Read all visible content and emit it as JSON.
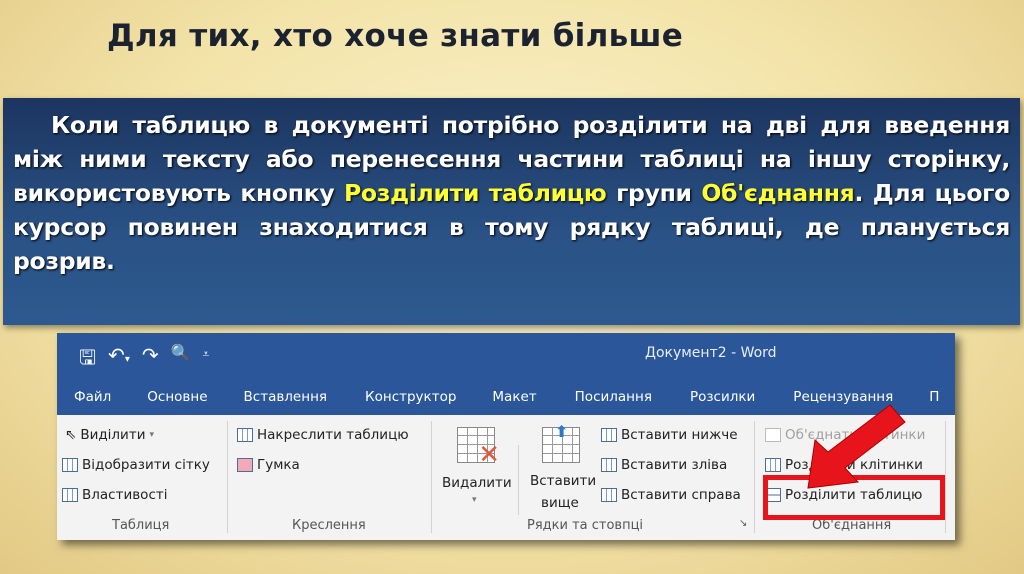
{
  "slide_title": "Для тих, хто хоче знати більше",
  "text": {
    "p1": "Коли таблицю в документі потрібно розділити на дві для введення між ними тексту або перенесення частини таблиці на іншу сторінку, використовують кнопку ",
    "hl1": "Розділити таблицю",
    "p2": " групи ",
    "hl2": "Об'єднання",
    "p3": ". Для цього курсор повинен знаходитися в тому рядку таблиці, де планується розрив."
  },
  "word": {
    "title": "Документ2 - Word",
    "qat": {
      "save": "🖫",
      "undo": "↶",
      "undo_more": "▾",
      "redo": "↷",
      "preview": "🔍",
      "customize": "⩡"
    },
    "tabs": [
      "Файл",
      "Основне",
      "Вставлення",
      "Конструктор",
      "Макет",
      "Посилання",
      "Розсилки",
      "Рецензування",
      "П"
    ],
    "ribbon": {
      "select": "Виділити",
      "select_caret": "▾",
      "gridlines": "Відобразити сітку",
      "properties": "Властивості",
      "group_table": "Таблиця",
      "draw_table": "Накреслити таблицю",
      "eraser": "Гумка",
      "group_draw": "Креслення",
      "delete": "Видалити",
      "delete_caret": "▾",
      "insert_above_1": "Вставити",
      "insert_above_2": "вище",
      "insert_below": "Вставити нижче",
      "insert_left": "Вставити зліва",
      "insert_right": "Вставити справа",
      "group_rows": "Рядки та стовпці",
      "launcher": "↘",
      "merge_cells": "Об'єднати клітинки",
      "split_cells": "Розділити клітинки",
      "split_table": "Розділити таблицю",
      "group_merge": "Об'єднання"
    }
  },
  "colors": {
    "word_blue": "#2b579a",
    "highlight": "#ffff33",
    "callout": "#e8141b"
  }
}
